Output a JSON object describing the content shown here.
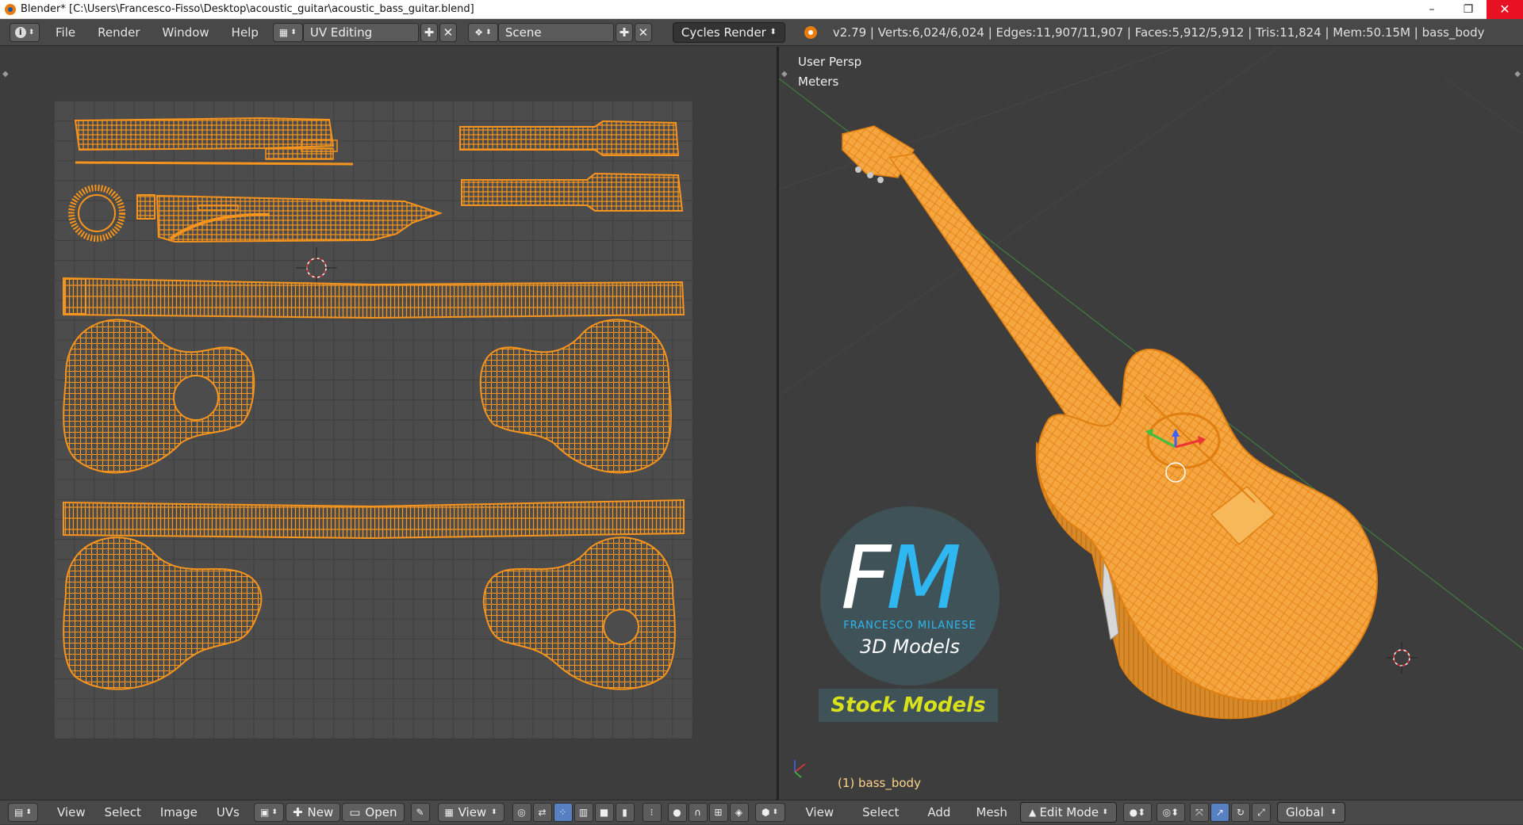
{
  "titlebar": {
    "title": "Blender* [C:\\Users\\Francesco-Fisso\\Desktop\\acoustic_guitar\\acoustic_bass_guitar.blend]",
    "minimize": "–",
    "restore": "❐",
    "close": "✕"
  },
  "topbar": {
    "menus": [
      "File",
      "Render",
      "Window",
      "Help"
    ],
    "screen_layout": "UV Editing",
    "scene": "Scene",
    "render_engine": "Cycles Render",
    "stats": "v2.79 | Verts:6,024/6,024 | Edges:11,907/11,907 | Faces:5,912/5,912 | Tris:11,824 | Mem:50.15M | bass_body"
  },
  "viewport": {
    "view_label": "User Persp",
    "units_label": "Meters",
    "object_label": "(1) bass_body"
  },
  "logo": {
    "f": "F",
    "m": "M",
    "name": "FRANCESCO MILANESE",
    "subtitle": "3D Models",
    "badge": "Stock Models"
  },
  "uv_footer": {
    "menus": [
      "View",
      "Select",
      "Image",
      "UVs"
    ],
    "new_label": "New",
    "open_label": "Open",
    "view_label": "View"
  },
  "view3d_footer": {
    "menus": [
      "View",
      "Select",
      "Add",
      "Mesh"
    ],
    "mode": "Edit Mode",
    "orientation": "Global"
  },
  "colors": {
    "wire": "#f7941d",
    "accent_blue": "#2eb7f0",
    "badge_yellow": "#d8e11c"
  }
}
